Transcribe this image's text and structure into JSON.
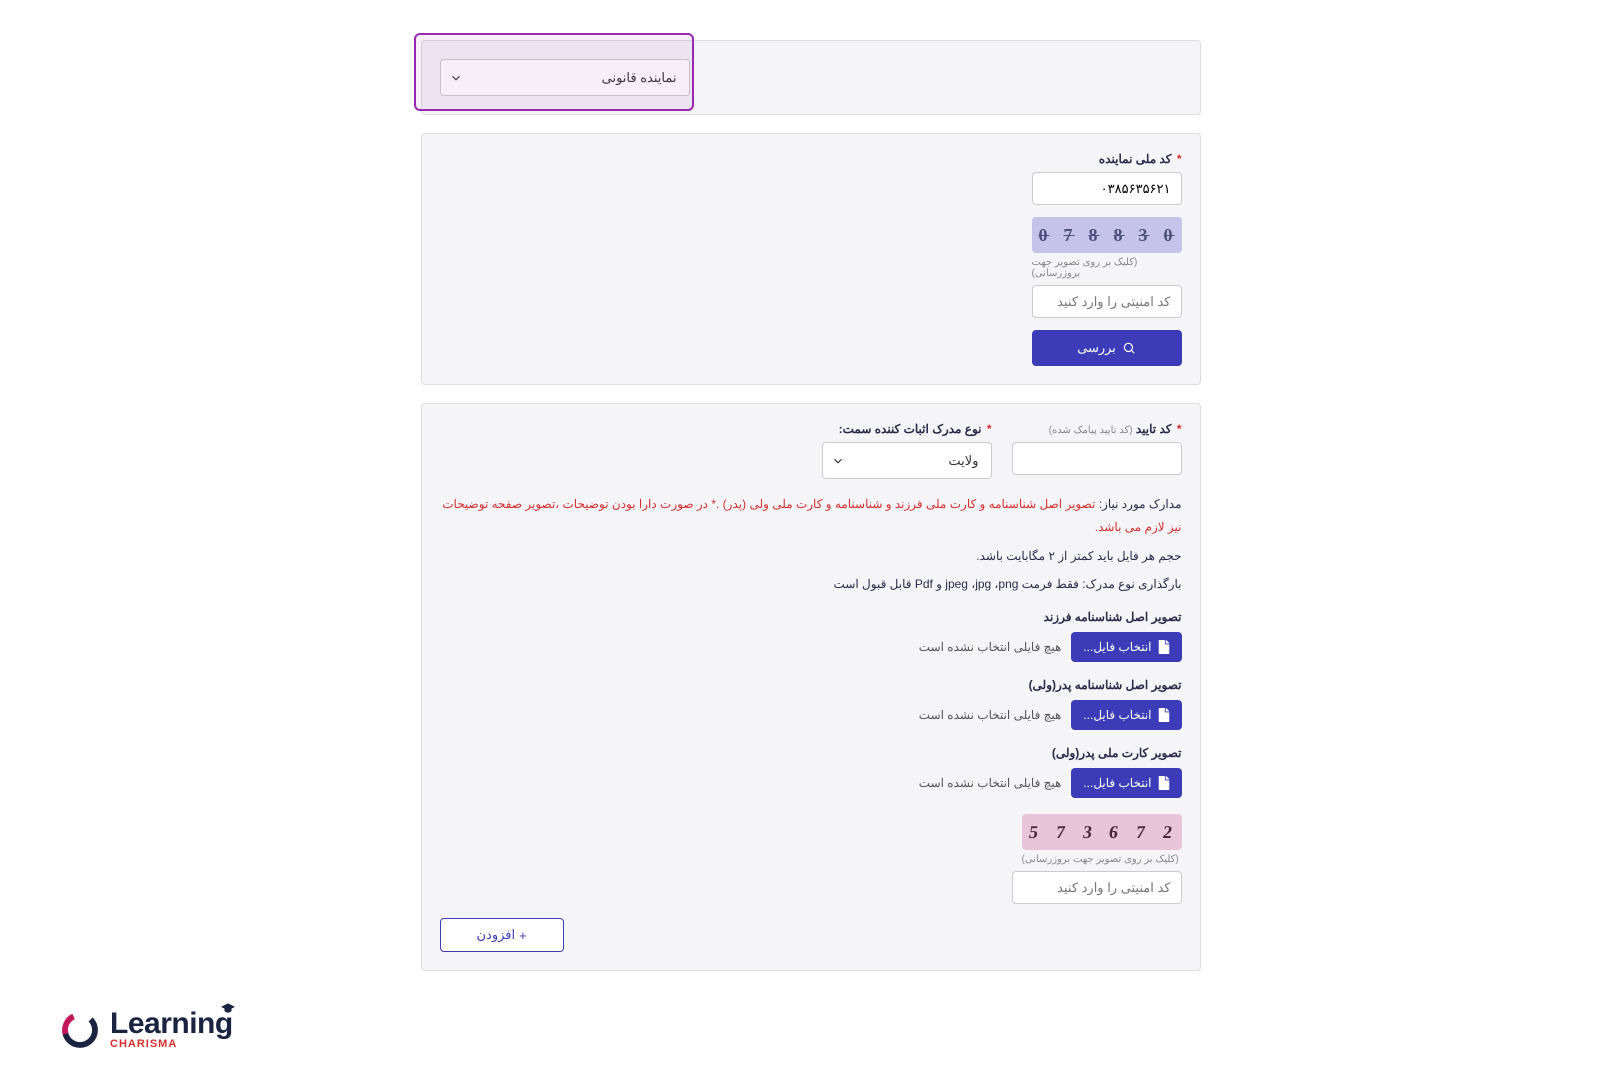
{
  "panel1": {
    "representative_type_select": "نماینده قانونی"
  },
  "panel2": {
    "national_id_label": "کد ملی نماینده",
    "national_id_value": "۰۳۸۵۶۳۵۶۲۱",
    "captcha_hint": "(کلیک بر روی تصویر جهت بروزرسانی)",
    "captcha_placeholder": "کد امنیتی را وارد کنید",
    "captcha_digits": [
      "0",
      "3",
      "8",
      "8",
      "7",
      "0"
    ],
    "check_button": "بررسی"
  },
  "panel3": {
    "confirm_code_label": "کد تایید",
    "confirm_code_hint": "(کد تایید پیامک شده)",
    "doc_type_label": "نوع مدرک اثبات کننده سمت:",
    "doc_type_value": "ولایت",
    "docs_needed_prefix": "مدارک مورد نیاز:",
    "docs_needed_main": "تصویر اصل شناسنامه و کارت ملی فرزند و شناسنامه و کارت ملی ولی (پدر) .* در صورت دارا بودن توضیحات ،تصویر صفحه توضیحات نیز لازم می باشد.",
    "size_note": "حجم هر فایل باید کمتر از ۲ مگابایت باشد.",
    "format_note": "بارگذاری نوع مدرک: فقط فرمت jpeg ،jpg ،png و Pdf قابل قبول است",
    "uploads": [
      {
        "label": "تصویر اصل شناسنامه فرزند",
        "status": "هیچ فایلی انتخاب نشده است"
      },
      {
        "label": "تصویر اصل شناسنامه پدر(ولی)",
        "status": "هیچ فایلی انتخاب نشده است"
      },
      {
        "label": "تصویر کارت ملی پدر(ولی)",
        "status": "هیچ فایلی انتخاب نشده است"
      }
    ],
    "choose_file_label": "انتخاب فایل...",
    "captcha2_digits": [
      "2",
      "7",
      "6",
      "3",
      "7",
      "5"
    ],
    "captcha_hint": "(کلیک بر روی تصویر جهت بروزرسانی)",
    "captcha_placeholder": "کد امنیتی را وارد کنید",
    "add_button": "افزودن"
  },
  "logo": {
    "main": "Learning",
    "sub": "CHARISMA"
  }
}
